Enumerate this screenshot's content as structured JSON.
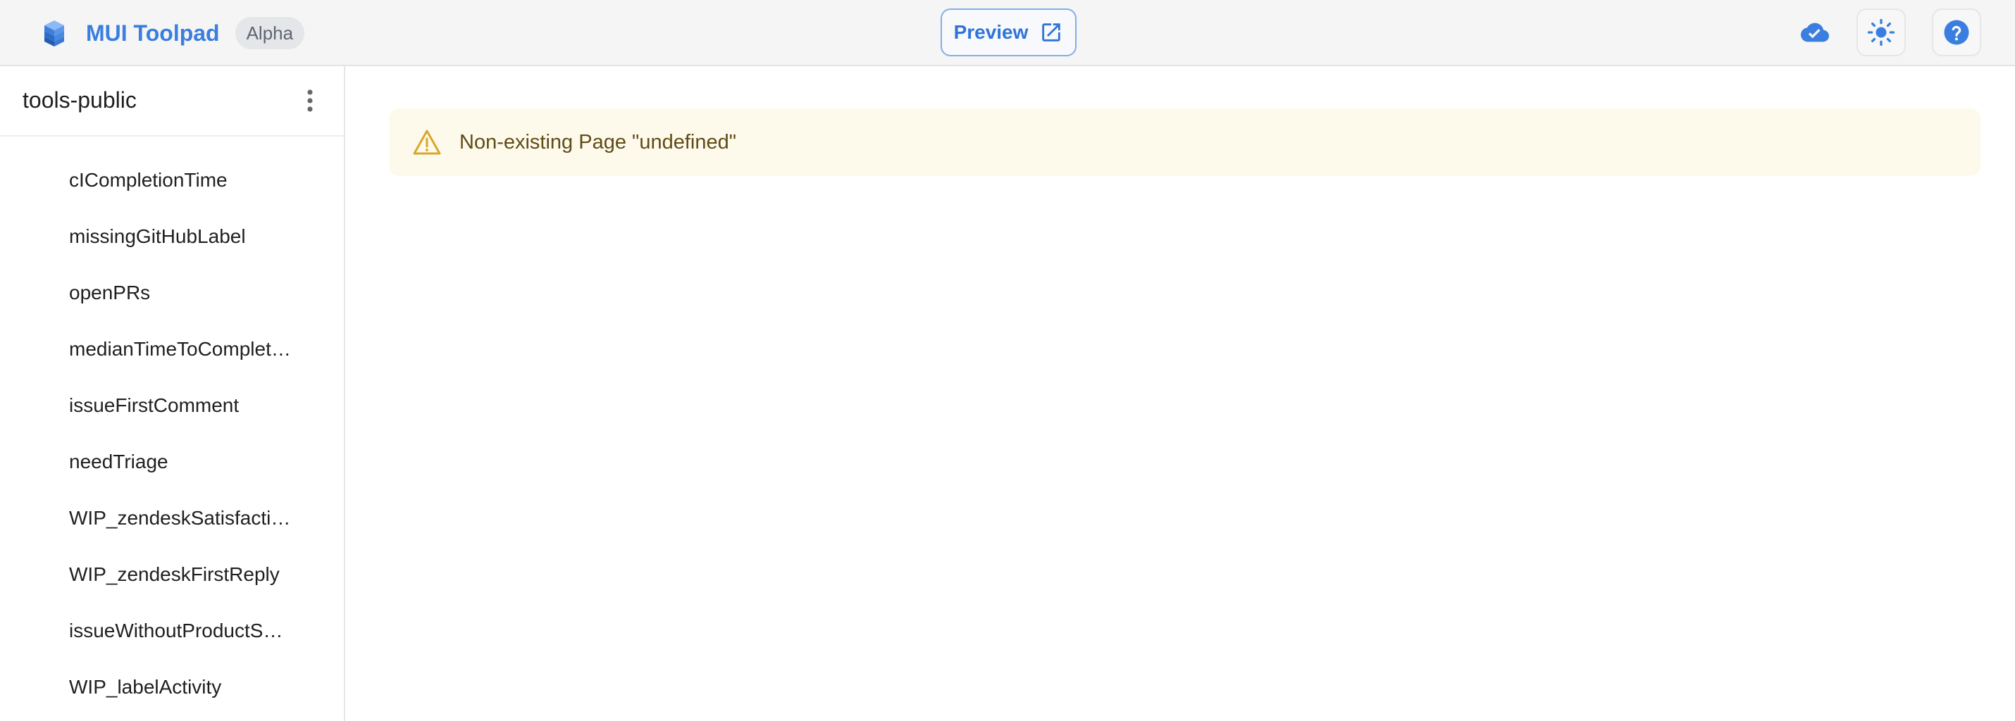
{
  "header": {
    "brand_name": "MUI Toolpad",
    "badge": "Alpha",
    "preview_label": "Preview",
    "icons": {
      "logo": "toolpad-logo-icon",
      "preview": "open-in-new-icon",
      "status": "cloud-done-icon",
      "theme": "light-mode-icon",
      "help": "help-icon"
    },
    "accent_color": "#3a7ee0"
  },
  "sidebar": {
    "project_name": "tools-public",
    "menu_icon": "more-vertical-icon",
    "pages": [
      {
        "label": "cICompletionTime"
      },
      {
        "label": "missingGitHubLabel"
      },
      {
        "label": "openPRs"
      },
      {
        "label": "medianTimeToCompletion"
      },
      {
        "label": "issueFirstComment"
      },
      {
        "label": "needTriage"
      },
      {
        "label": "WIP_zendeskSatisfaction"
      },
      {
        "label": "WIP_zendeskFirstReply"
      },
      {
        "label": "issueWithoutProductScope"
      },
      {
        "label": "WIP_labelActivity"
      }
    ]
  },
  "main": {
    "alert": {
      "severity": "warning",
      "icon": "warning-icon",
      "message": "Non-existing Page \"undefined\"",
      "background_color": "#fefaeb",
      "icon_color": "#d9a62a"
    }
  }
}
